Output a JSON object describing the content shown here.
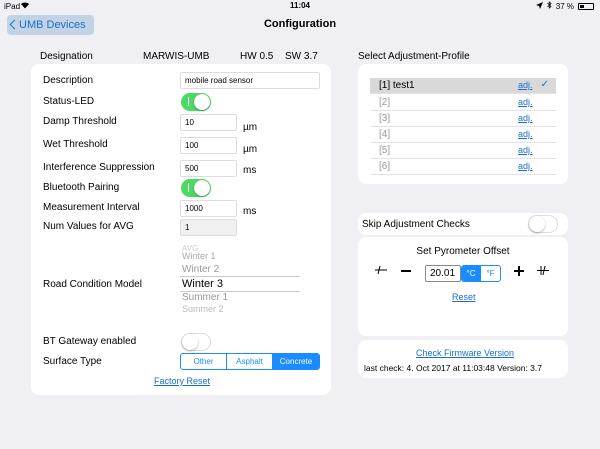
{
  "status": {
    "carrier": "iPad",
    "time": "11:04",
    "battery": "37 %",
    "battery_level": 0.37
  },
  "nav": {
    "back_label": "UMB Devices",
    "title": "Configuration"
  },
  "device": {
    "designation_label": "Designation",
    "model": "MARWIS-UMB",
    "hw": "HW 0.5",
    "sw": "SW  3.7"
  },
  "config": {
    "description_label": "Description",
    "description_value": "mobile road sensor",
    "status_led_label": "Status-LED",
    "damp_label": "Damp Threshold",
    "damp_value": "10",
    "damp_unit": "µm",
    "wet_label": "Wet Threshold",
    "wet_value": "100",
    "wet_unit": "µm",
    "interference_label": "Interference Suppression",
    "interference_value": "500",
    "interference_unit": "ms",
    "bluetooth_label": "Bluetooth Pairing",
    "interval_label": "Measurement Interval",
    "interval_value": "1000",
    "interval_unit": "ms",
    "num_values_label": "Num Values for AVG",
    "num_values_value": "1",
    "road_model_label": "Road Condition Model",
    "road_model_options": [
      "AVG",
      "Winter 1",
      "Winter 2",
      "Winter 3",
      "Summer 1",
      "Summer 2"
    ],
    "bt_gateway_label": "BT Gateway enabled",
    "surface_label": "Surface Type",
    "surface_options": [
      "Other",
      "Asphalt",
      "Concrete"
    ],
    "factory_reset": "Factory Reset"
  },
  "profiles": {
    "title": "Select Adjustment-Profile",
    "items": [
      {
        "name": "[1] test1",
        "adj": "adj."
      },
      {
        "name": "[2]",
        "adj": "adj."
      },
      {
        "name": "[3]",
        "adj": "adj."
      },
      {
        "name": "[4]",
        "adj": "adj."
      },
      {
        "name": "[5]",
        "adj": "adj."
      },
      {
        "name": "[6]",
        "adj": "adj."
      }
    ],
    "check": "✓"
  },
  "skip": {
    "label": "Skip Adjustment Checks"
  },
  "pyrometer": {
    "title": "Set Pyrometer Offset",
    "value": "20.01",
    "unit_c": "°C",
    "unit_f": "°F",
    "reset": "Reset"
  },
  "firmware": {
    "link": "Check Firmware Version",
    "last_check": "last check: 4. Oct 2017 at 11:03:48 Version: 3.7"
  },
  "colors": {
    "accent": "#1a8cff",
    "toggle_on": "#4cd964",
    "background": "#efeff4"
  }
}
